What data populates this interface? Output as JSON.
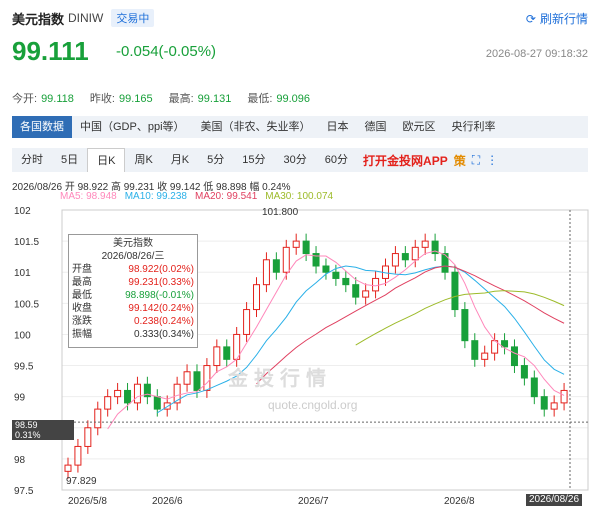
{
  "header": {
    "name": "美元指数",
    "code": "DINIW",
    "status": "交易中",
    "refresh": "刷新行情"
  },
  "quote": {
    "price": "99.111",
    "change": "-0.054(-0.05%)",
    "time": "2026-08-27 09:18:32"
  },
  "stats": [
    {
      "label": "今开:",
      "value": "99.118"
    },
    {
      "label": "昨收:",
      "value": "99.165"
    },
    {
      "label": "最高:",
      "value": "99.131"
    },
    {
      "label": "最低:",
      "value": "99.096"
    }
  ],
  "tabs1": [
    "各国数据",
    "中国（GDP、ppi等）",
    "美国（非农、失业率）",
    "日本",
    "德国",
    "欧元区",
    "央行利率"
  ],
  "tabs2": [
    "分时",
    "5日",
    "日K",
    "周K",
    "月K",
    "5分",
    "15分",
    "30分",
    "60分"
  ],
  "app_link": "打开金投网APP",
  "strategy": "策",
  "ohlc": "2026/08/26 开 98.922 高 99.231 收 99.142 低 98.898 幅 0.24%",
  "ma": [
    {
      "label": "MA5: 98.948",
      "color": "#ff88bb"
    },
    {
      "label": "MA10: 99.238",
      "color": "#2ab0e8"
    },
    {
      "label": "MA20: 99.541",
      "color": "#e04060"
    },
    {
      "label": "MA30: 100.074",
      "color": "#9dbb2a"
    }
  ],
  "yticks": [
    "102",
    "101.5",
    "101",
    "100.5",
    "100",
    "99.5",
    "99",
    "98.5",
    "98",
    "97.5"
  ],
  "xticks": [
    "2026/5/8",
    "2026/6",
    "2026/7",
    "2026/8"
  ],
  "cursor": {
    "price": "98.59",
    "pct": "0.31%",
    "date": "2026/08/26"
  },
  "tooltip": {
    "title": "美元指数",
    "date": "2026/08/26/三",
    "rows": [
      {
        "k": "开盘",
        "v": "98.922(0.02%)",
        "c": "red"
      },
      {
        "k": "最高",
        "v": "99.231(0.33%)",
        "c": "red"
      },
      {
        "k": "最低",
        "v": "98.898(-0.01%)",
        "c": "g"
      },
      {
        "k": "收盘",
        "v": "99.142(0.24%)",
        "c": "red"
      },
      {
        "k": "涨跌",
        "v": "0.238(0.24%)",
        "c": "red"
      },
      {
        "k": "振幅",
        "v": "0.333(0.34%)",
        "c": ""
      }
    ]
  },
  "labels": {
    "high": "101.800",
    "low": "97.829"
  },
  "watermark": {
    "cn": "金投行情",
    "url": "quote.cngold.org"
  },
  "chart_data": {
    "type": "candlestick",
    "ylim": [
      97.5,
      102
    ],
    "categories": [
      "2026/5/8",
      "2026/6",
      "2026/7",
      "2026/8",
      "2026/08/26"
    ],
    "series": [
      {
        "name": "MA5",
        "values": []
      },
      {
        "name": "MA10",
        "values": []
      },
      {
        "name": "MA20",
        "values": []
      },
      {
        "name": "MA30",
        "values": []
      }
    ],
    "closes": [
      97.9,
      98.2,
      98.5,
      98.8,
      99.0,
      99.1,
      98.9,
      99.2,
      99.0,
      98.8,
      98.9,
      99.2,
      99.4,
      99.1,
      99.5,
      99.8,
      99.6,
      100.0,
      100.4,
      100.8,
      101.2,
      101.0,
      101.4,
      101.5,
      101.3,
      101.1,
      101.0,
      100.9,
      100.8,
      100.6,
      100.7,
      100.9,
      101.1,
      101.3,
      101.2,
      101.4,
      101.5,
      101.3,
      101.0,
      100.4,
      99.9,
      99.6,
      99.7,
      99.9,
      99.8,
      99.5,
      99.3,
      99.0,
      98.8,
      98.9,
      99.1
    ]
  }
}
